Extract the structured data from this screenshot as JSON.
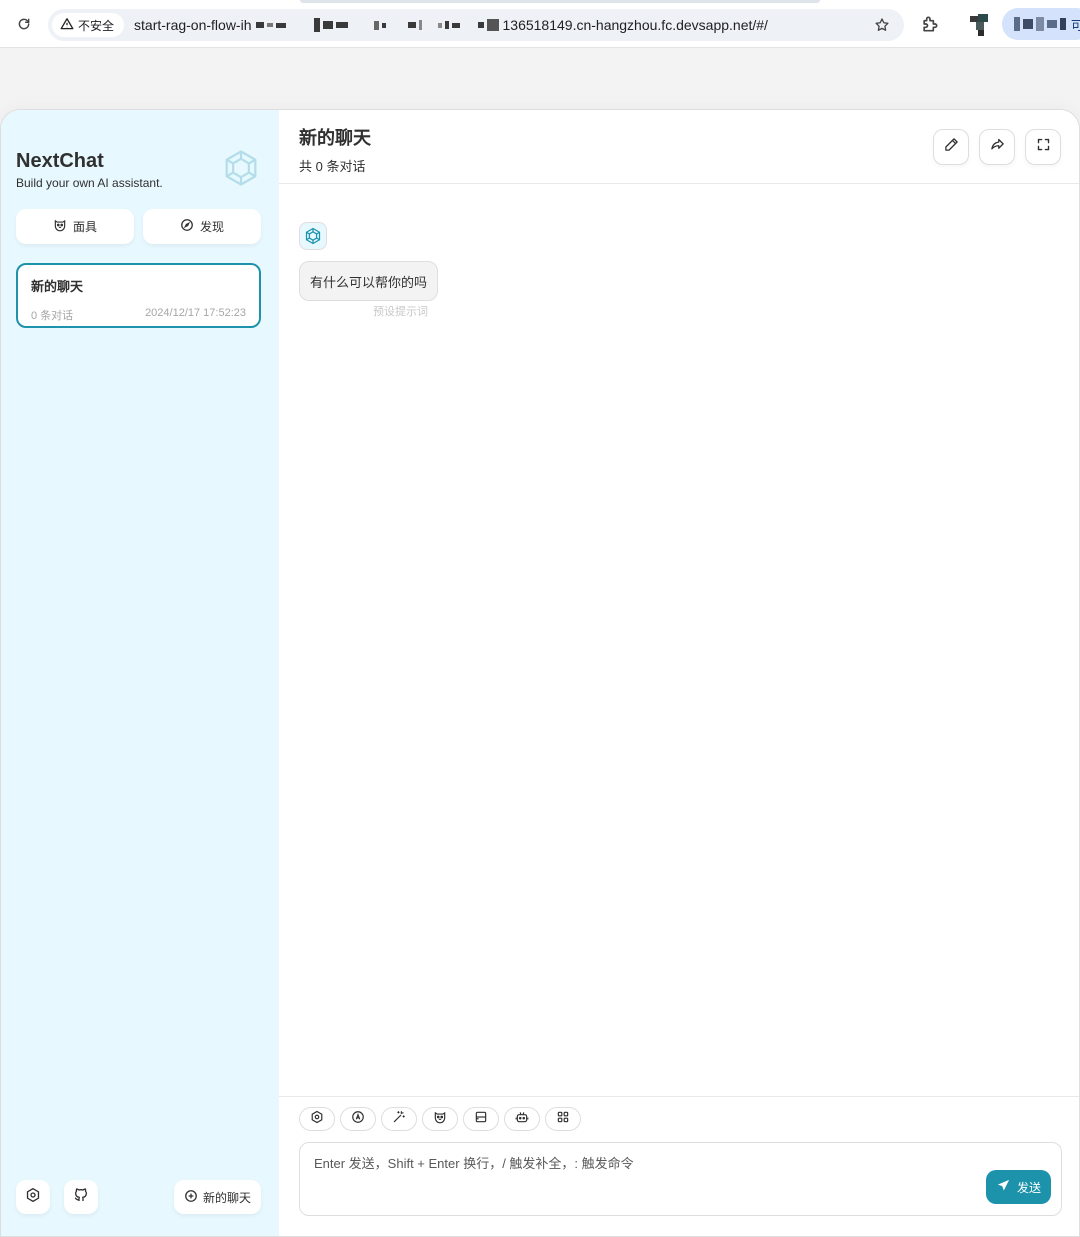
{
  "browser": {
    "security_label": "不安全",
    "url_prefix": "start-rag-on-flow-ih",
    "url_suffix": "136518149.cn-hangzhou.fc.devsapp.net/#/",
    "profile_label": "可"
  },
  "sidebar": {
    "title": "NextChat",
    "subtitle": "Build your own AI assistant.",
    "mask_button": "面具",
    "discover_button": "发现",
    "chat_list": [
      {
        "title": "新的聊天",
        "count": "0 条对话",
        "time": "2024/12/17 17:52:23"
      }
    ],
    "new_chat_button": "新的聊天"
  },
  "chat": {
    "title": "新的聊天",
    "subtitle": "共 0 条对话",
    "greeting": "有什么可以帮你的吗",
    "greeting_hint": "预设提示词",
    "input_placeholder": "Enter 发送，Shift + Enter 换行，/ 触发补全，: 触发命令",
    "send_button": "发送"
  },
  "colors": {
    "accent": "#1d93ab",
    "sidebar_bg": "#e7f8ff",
    "bubble_bg": "#f3f3f3"
  }
}
